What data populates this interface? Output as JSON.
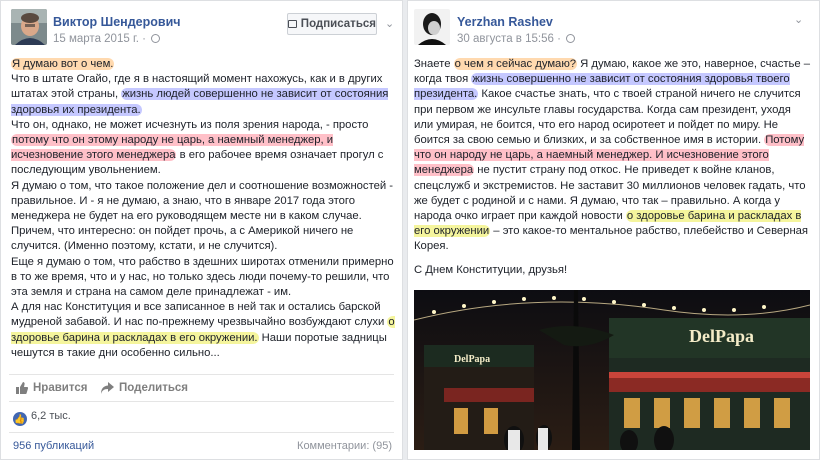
{
  "left_post": {
    "author": "Виктор Шендерович",
    "date": "15 марта 2015 г.",
    "subscribe_label": "Подписаться",
    "paragraphs": [
      {
        "segments": [
          {
            "text": "Я думаю вот о чем.",
            "hl": "o"
          }
        ]
      },
      {
        "segments": [
          {
            "text": "Что в штате Огайо, где я в настоящий момент нахожусь, как и в других штатах этой страны, "
          },
          {
            "text": "жизнь людей совершенно не зависит от состояния здоровья их президента.",
            "hl": "b"
          }
        ]
      },
      {
        "segments": [
          {
            "text": "Что он, однако, не может исчезнуть из поля зрения народа, - просто "
          },
          {
            "text": "потому что он этому народу не царь, а наемный менеджер, и исчезновение этого менеджера",
            "hl": "r"
          },
          {
            "text": " в его рабочее время означает прогул с последующим увольнением."
          }
        ]
      },
      {
        "segments": [
          {
            "text": "Я думаю о том, что такое положение дел и соотношение возможностей - правильное. И - я не думаю, а знаю, что в январе 2017 года этого менеджера не будет на его руководящем месте ни в каком случае. Причем, что интересно: он пойдет прочь, а с Америкой ничего не случится. (Именно поэтому, кстати, и не случится)."
          }
        ]
      },
      {
        "segments": [
          {
            "text": "Еще я думаю о том, что рабство в здешних широтах отменили примерно в то же время, что и у нас, но только здесь люди почему-то решили, что эта земля и страна на самом деле принадлежат - им."
          }
        ]
      },
      {
        "segments": [
          {
            "text": "А для нас Конституция и все записанное в ней так и остались барской мудреной забавой. И нас по-прежнему чрезвычайно возбуждают слухи "
          },
          {
            "text": "о здоровье барина и раскладах в его окружении.",
            "hl": "y"
          },
          {
            "text": " Наши поротые задницы чешутся в такие дни особенно сильно..."
          }
        ]
      }
    ],
    "like_label": "Нравится",
    "share_label": "Поделиться",
    "reactions_count": "6,2 тыс.",
    "publications": "956 публикаций",
    "comments": "Комментарии: (95)"
  },
  "right_post": {
    "author": "Yerzhan Rashev",
    "date": "30 августа в 15:56",
    "paragraphs": [
      {
        "segments": [
          {
            "text": "Знаете "
          },
          {
            "text": "о чем я сейчас думаю?",
            "hl": "o"
          },
          {
            "text": " Я думаю, какое же это, наверное, счастье – когда твоя "
          },
          {
            "text": "жизнь совершенно не зависит от состояния здоровья твоего президента.",
            "hl": "b"
          },
          {
            "text": " Какое счастье знать, что с твоей страной ничего не случится при первом же инсульте главы государства. Когда сам президент, уходя или умирая, не боится, что его народ осиротеет и пойдет по миру. Не боится за свою семью и близких, и за собственное имя в истории. "
          },
          {
            "text": "Потому что он народу не царь, а наемный менеджер. И исчезновение этого менеджера",
            "hl": "r"
          },
          {
            "text": " не пустит страну под откос. Не приведет к войне кланов, спецслужб и экстремистов. Не заставит 30 миллионов человек гадать, что же будет с родиной и с нами. Я думаю, что так – правильно. А когда у народа очко играет при каждой новости "
          },
          {
            "text": "о здоровье барина и раскладах в его окружении",
            "hl": "y"
          },
          {
            "text": " – это какое-то ментальное рабство, плебейство и Северная Корея."
          }
        ]
      },
      {
        "segments": [
          {
            "text": "С Днем Конституции, друзья!"
          }
        ]
      }
    ],
    "photo_sign_main": "DelPapa",
    "photo_sign_left": "DelPapa"
  },
  "colors": {
    "link": "#365899",
    "highlight_blue": "#666eff",
    "highlight_red": "#ff5a6e",
    "highlight_yellow": "#ebeb3c",
    "highlight_orange": "#ffb96e"
  }
}
